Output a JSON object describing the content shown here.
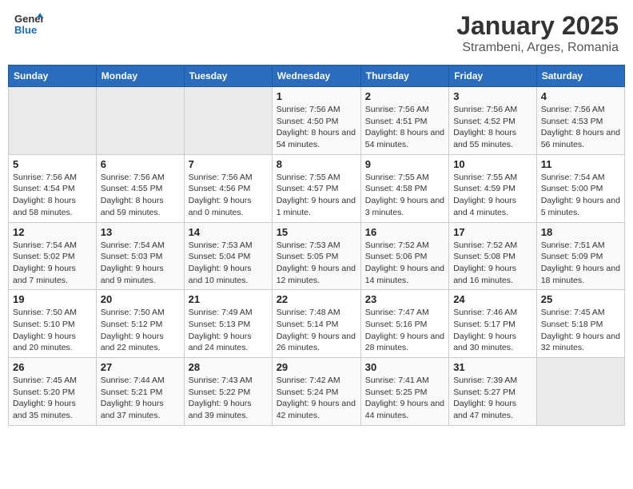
{
  "header": {
    "logo_line1": "General",
    "logo_line2": "Blue",
    "month": "January 2025",
    "location": "Strambeni, Arges, Romania"
  },
  "weekdays": [
    "Sunday",
    "Monday",
    "Tuesday",
    "Wednesday",
    "Thursday",
    "Friday",
    "Saturday"
  ],
  "weeks": [
    [
      {
        "day": "",
        "sunrise": "",
        "sunset": "",
        "daylight": ""
      },
      {
        "day": "",
        "sunrise": "",
        "sunset": "",
        "daylight": ""
      },
      {
        "day": "",
        "sunrise": "",
        "sunset": "",
        "daylight": ""
      },
      {
        "day": "1",
        "sunrise": "Sunrise: 7:56 AM",
        "sunset": "Sunset: 4:50 PM",
        "daylight": "Daylight: 8 hours and 54 minutes."
      },
      {
        "day": "2",
        "sunrise": "Sunrise: 7:56 AM",
        "sunset": "Sunset: 4:51 PM",
        "daylight": "Daylight: 8 hours and 54 minutes."
      },
      {
        "day": "3",
        "sunrise": "Sunrise: 7:56 AM",
        "sunset": "Sunset: 4:52 PM",
        "daylight": "Daylight: 8 hours and 55 minutes."
      },
      {
        "day": "4",
        "sunrise": "Sunrise: 7:56 AM",
        "sunset": "Sunset: 4:53 PM",
        "daylight": "Daylight: 8 hours and 56 minutes."
      }
    ],
    [
      {
        "day": "5",
        "sunrise": "Sunrise: 7:56 AM",
        "sunset": "Sunset: 4:54 PM",
        "daylight": "Daylight: 8 hours and 58 minutes."
      },
      {
        "day": "6",
        "sunrise": "Sunrise: 7:56 AM",
        "sunset": "Sunset: 4:55 PM",
        "daylight": "Daylight: 8 hours and 59 minutes."
      },
      {
        "day": "7",
        "sunrise": "Sunrise: 7:56 AM",
        "sunset": "Sunset: 4:56 PM",
        "daylight": "Daylight: 9 hours and 0 minutes."
      },
      {
        "day": "8",
        "sunrise": "Sunrise: 7:55 AM",
        "sunset": "Sunset: 4:57 PM",
        "daylight": "Daylight: 9 hours and 1 minute."
      },
      {
        "day": "9",
        "sunrise": "Sunrise: 7:55 AM",
        "sunset": "Sunset: 4:58 PM",
        "daylight": "Daylight: 9 hours and 3 minutes."
      },
      {
        "day": "10",
        "sunrise": "Sunrise: 7:55 AM",
        "sunset": "Sunset: 4:59 PM",
        "daylight": "Daylight: 9 hours and 4 minutes."
      },
      {
        "day": "11",
        "sunrise": "Sunrise: 7:54 AM",
        "sunset": "Sunset: 5:00 PM",
        "daylight": "Daylight: 9 hours and 5 minutes."
      }
    ],
    [
      {
        "day": "12",
        "sunrise": "Sunrise: 7:54 AM",
        "sunset": "Sunset: 5:02 PM",
        "daylight": "Daylight: 9 hours and 7 minutes."
      },
      {
        "day": "13",
        "sunrise": "Sunrise: 7:54 AM",
        "sunset": "Sunset: 5:03 PM",
        "daylight": "Daylight: 9 hours and 9 minutes."
      },
      {
        "day": "14",
        "sunrise": "Sunrise: 7:53 AM",
        "sunset": "Sunset: 5:04 PM",
        "daylight": "Daylight: 9 hours and 10 minutes."
      },
      {
        "day": "15",
        "sunrise": "Sunrise: 7:53 AM",
        "sunset": "Sunset: 5:05 PM",
        "daylight": "Daylight: 9 hours and 12 minutes."
      },
      {
        "day": "16",
        "sunrise": "Sunrise: 7:52 AM",
        "sunset": "Sunset: 5:06 PM",
        "daylight": "Daylight: 9 hours and 14 minutes."
      },
      {
        "day": "17",
        "sunrise": "Sunrise: 7:52 AM",
        "sunset": "Sunset: 5:08 PM",
        "daylight": "Daylight: 9 hours and 16 minutes."
      },
      {
        "day": "18",
        "sunrise": "Sunrise: 7:51 AM",
        "sunset": "Sunset: 5:09 PM",
        "daylight": "Daylight: 9 hours and 18 minutes."
      }
    ],
    [
      {
        "day": "19",
        "sunrise": "Sunrise: 7:50 AM",
        "sunset": "Sunset: 5:10 PM",
        "daylight": "Daylight: 9 hours and 20 minutes."
      },
      {
        "day": "20",
        "sunrise": "Sunrise: 7:50 AM",
        "sunset": "Sunset: 5:12 PM",
        "daylight": "Daylight: 9 hours and 22 minutes."
      },
      {
        "day": "21",
        "sunrise": "Sunrise: 7:49 AM",
        "sunset": "Sunset: 5:13 PM",
        "daylight": "Daylight: 9 hours and 24 minutes."
      },
      {
        "day": "22",
        "sunrise": "Sunrise: 7:48 AM",
        "sunset": "Sunset: 5:14 PM",
        "daylight": "Daylight: 9 hours and 26 minutes."
      },
      {
        "day": "23",
        "sunrise": "Sunrise: 7:47 AM",
        "sunset": "Sunset: 5:16 PM",
        "daylight": "Daylight: 9 hours and 28 minutes."
      },
      {
        "day": "24",
        "sunrise": "Sunrise: 7:46 AM",
        "sunset": "Sunset: 5:17 PM",
        "daylight": "Daylight: 9 hours and 30 minutes."
      },
      {
        "day": "25",
        "sunrise": "Sunrise: 7:45 AM",
        "sunset": "Sunset: 5:18 PM",
        "daylight": "Daylight: 9 hours and 32 minutes."
      }
    ],
    [
      {
        "day": "26",
        "sunrise": "Sunrise: 7:45 AM",
        "sunset": "Sunset: 5:20 PM",
        "daylight": "Daylight: 9 hours and 35 minutes."
      },
      {
        "day": "27",
        "sunrise": "Sunrise: 7:44 AM",
        "sunset": "Sunset: 5:21 PM",
        "daylight": "Daylight: 9 hours and 37 minutes."
      },
      {
        "day": "28",
        "sunrise": "Sunrise: 7:43 AM",
        "sunset": "Sunset: 5:22 PM",
        "daylight": "Daylight: 9 hours and 39 minutes."
      },
      {
        "day": "29",
        "sunrise": "Sunrise: 7:42 AM",
        "sunset": "Sunset: 5:24 PM",
        "daylight": "Daylight: 9 hours and 42 minutes."
      },
      {
        "day": "30",
        "sunrise": "Sunrise: 7:41 AM",
        "sunset": "Sunset: 5:25 PM",
        "daylight": "Daylight: 9 hours and 44 minutes."
      },
      {
        "day": "31",
        "sunrise": "Sunrise: 7:39 AM",
        "sunset": "Sunset: 5:27 PM",
        "daylight": "Daylight: 9 hours and 47 minutes."
      },
      {
        "day": "",
        "sunrise": "",
        "sunset": "",
        "daylight": ""
      }
    ]
  ]
}
